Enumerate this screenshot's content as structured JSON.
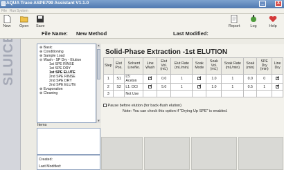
{
  "window": {
    "title": "AQUA Trace ASPE799 Assistant V1.1.0",
    "minimize": "_",
    "close": "X"
  },
  "menubar": {
    "items": [
      "File",
      "Run",
      "System"
    ]
  },
  "toolbar": {
    "new": "New",
    "open": "Open",
    "save": "Save",
    "report": "Report",
    "log": "Log",
    "help": "Help"
  },
  "file": {
    "label": "File Name:",
    "value": "New Method",
    "modified_label": "Last Modified:"
  },
  "sidebar": {
    "logo_text": "SLUICES Inc"
  },
  "tree": {
    "items": [
      "Basic",
      "Conditioning",
      "Sample Load",
      "Wash - SP Dry - Elution",
      "1st SPE RINSE",
      "1st SPE DRY",
      "1st SPE ELUTE",
      "2nd SPE RINSE",
      "2nd SPE DRY",
      "2nd SPE ELUTE",
      "Evaporation",
      "Cleaning"
    ]
  },
  "items_label": "Items",
  "created": {
    "created_label": "Created:",
    "modified_label": "Last Modified:"
  },
  "main": {
    "heading": "Solid-Phase Extraction -1st ELUTION",
    "columns": [
      "Step",
      "Elut Pos.",
      "Solvent LineNo.",
      "Line Wash",
      "Elut Vol. (mL)",
      "Elut Rate (mL/min)",
      "Soak Mode",
      "Soak Vol. (mL)",
      "Soak Rate (mL/min)",
      "Soak (min)",
      "SPE Dry (min)",
      "Line Dry"
    ],
    "rows": [
      {
        "step": "1",
        "pos": "S1",
        "solvent": "L5: Aceton",
        "line_wash": true,
        "vol": "0.0",
        "rate": "1",
        "soak_mode": true,
        "soak_vol": "1.0",
        "soak_rate": "1",
        "soak": "0.0",
        "spe_dry": "0",
        "line_dry": true
      },
      {
        "step": "2",
        "pos": "S2",
        "solvent": "L1: DCl",
        "line_wash": true,
        "vol": "5.0",
        "rate": "1",
        "soak_mode": true,
        "soak_vol": "1.0",
        "soak_rate": "1",
        "soak": "0.5",
        "spe_dry": "1",
        "line_dry": true
      },
      {
        "step": "3",
        "pos": "",
        "solvent": "Not Use"
      }
    ],
    "pause": "Pause before elution (for back-flush elution)",
    "note": "Note: You can check this option if \"Drying Up SPE\" is enabled."
  },
  "colors": {
    "titlebar": "#5b82b8",
    "accent": "#b7d3ea",
    "close": "#d9534f"
  }
}
